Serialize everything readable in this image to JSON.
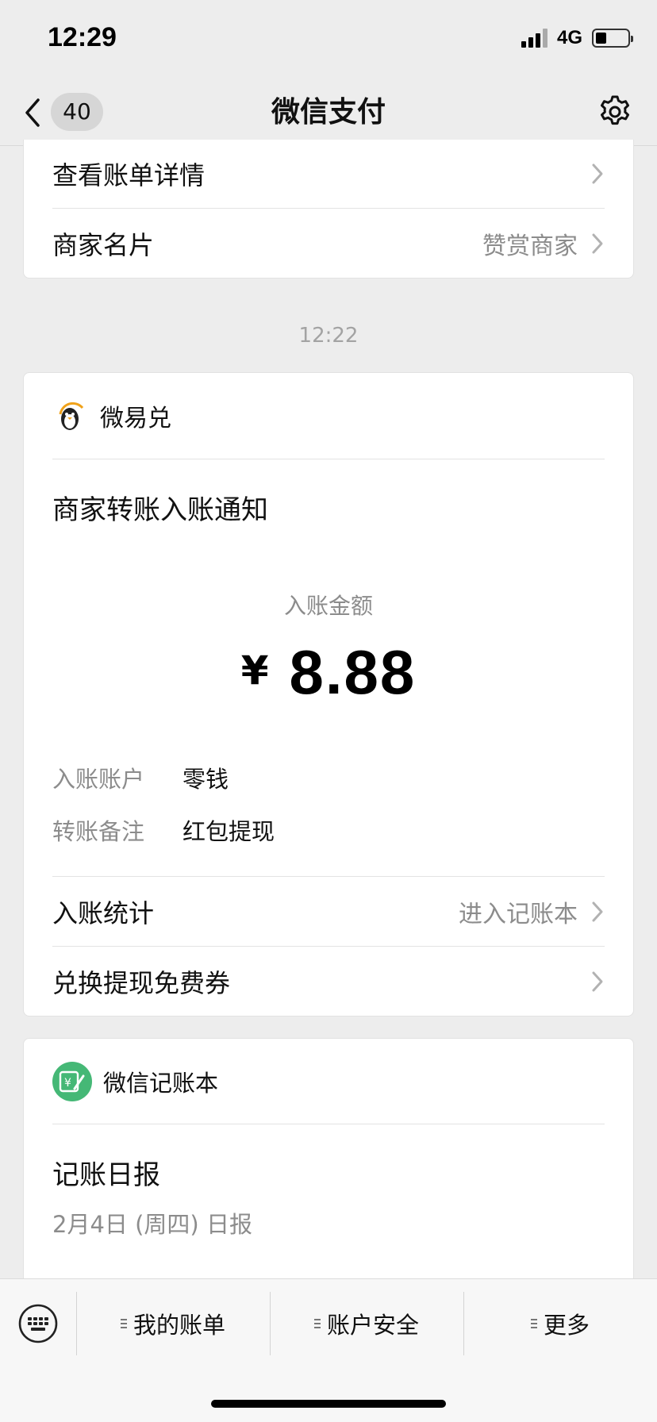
{
  "status_bar": {
    "time": "12:29",
    "network": "4G",
    "battery_level": 0.34
  },
  "nav": {
    "unread_count": "40",
    "title": "微信支付"
  },
  "top_card": {
    "rows": [
      {
        "label": "查看账单详情",
        "sub": ""
      },
      {
        "label": "商家名片",
        "sub": "赞赏商家"
      }
    ]
  },
  "timestamp": "12:22",
  "notice_card": {
    "merchant": "微易兑",
    "title": "商家转账入账通知",
    "amount_label": "入账金额",
    "currency": "¥",
    "amount": "8.88",
    "details": [
      {
        "key": "入账账户",
        "value": "零钱"
      },
      {
        "key": "转账备注",
        "value": "红包提现"
      }
    ],
    "rows": [
      {
        "label": "入账统计",
        "sub": "进入记账本"
      },
      {
        "label": "兑换提现免费券",
        "sub": ""
      }
    ]
  },
  "book_card": {
    "name": "微信记账本",
    "title": "记账日报",
    "subtitle": "2月4日 (周四) 日报",
    "logo_symbol": "¥"
  },
  "toolbar": {
    "items": [
      "我的账单",
      "账户安全",
      "更多"
    ]
  },
  "colors": {
    "accent_green": "#45b876",
    "background": "#ededed"
  }
}
